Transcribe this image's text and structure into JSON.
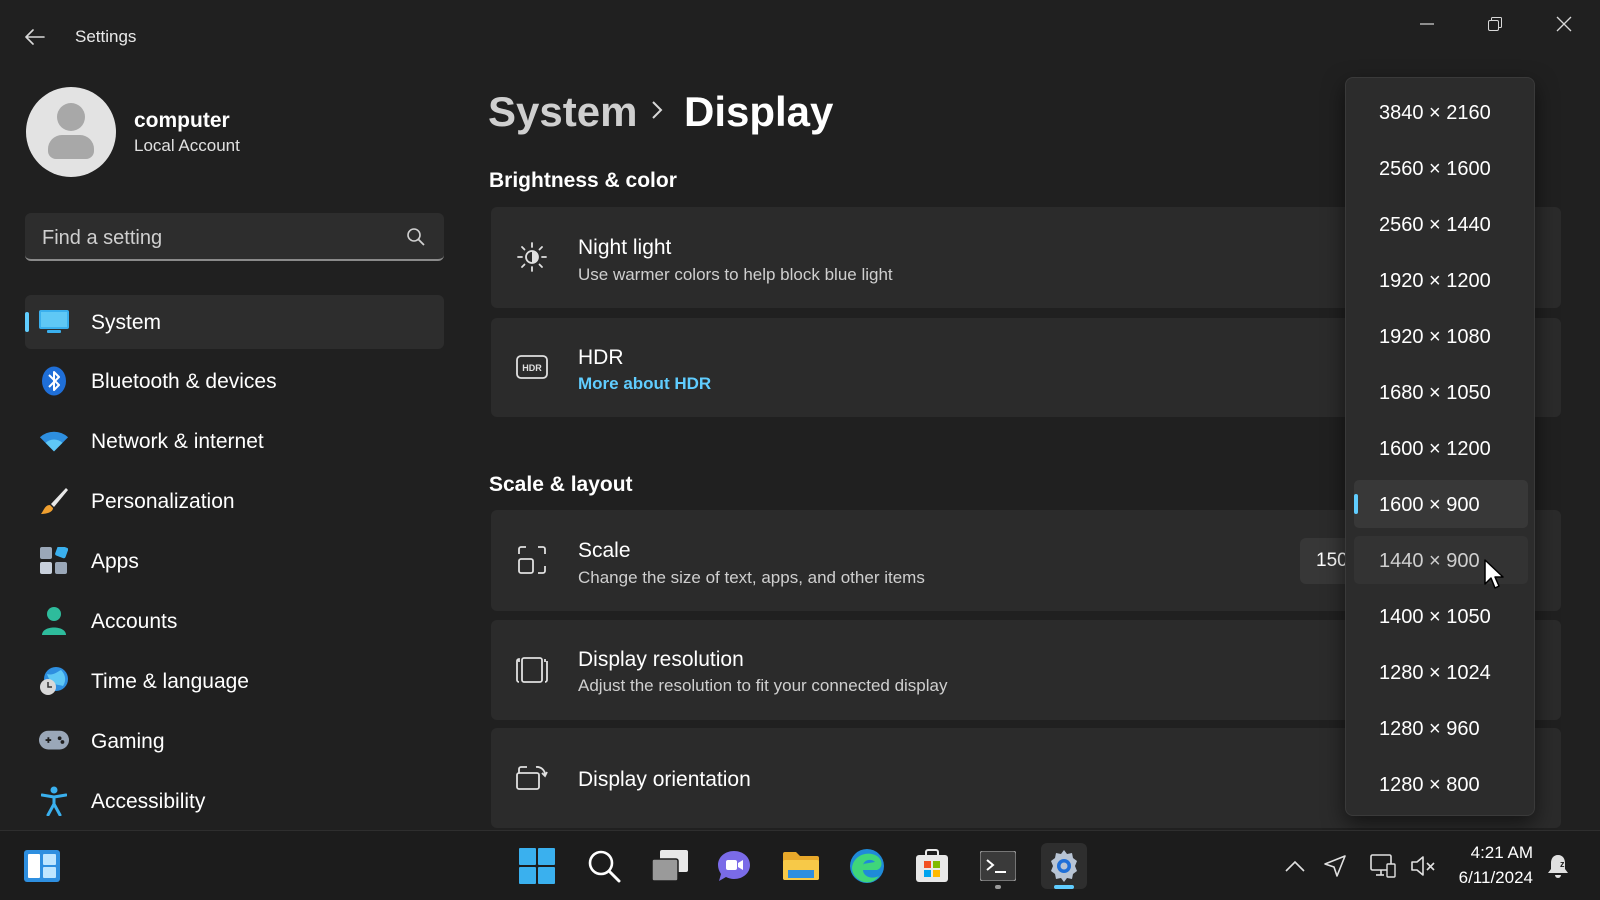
{
  "titlebar": {
    "app_title": "Settings"
  },
  "user": {
    "name": "computer",
    "account_type": "Local Account"
  },
  "search": {
    "placeholder": "Find a setting"
  },
  "sidebar": {
    "items": [
      {
        "label": "System",
        "icon": "monitor-icon",
        "selected": true
      },
      {
        "label": "Bluetooth & devices",
        "icon": "bluetooth-icon"
      },
      {
        "label": "Network & internet",
        "icon": "wifi-icon"
      },
      {
        "label": "Personalization",
        "icon": "brush-icon"
      },
      {
        "label": "Apps",
        "icon": "apps-icon"
      },
      {
        "label": "Accounts",
        "icon": "account-icon"
      },
      {
        "label": "Time & language",
        "icon": "globe-clock-icon"
      },
      {
        "label": "Gaming",
        "icon": "gamepad-icon"
      },
      {
        "label": "Accessibility",
        "icon": "accessibility-icon"
      }
    ]
  },
  "breadcrumb": {
    "parent": "System",
    "current": "Display"
  },
  "sections": {
    "brightness": "Brightness & color",
    "scale_layout": "Scale & layout"
  },
  "cards": {
    "night_light": {
      "title": "Night light",
      "subtitle": "Use warmer colors to help block blue light"
    },
    "hdr": {
      "title": "HDR",
      "link": "More about HDR"
    },
    "scale": {
      "title": "Scale",
      "subtitle": "Change the size of text, apps, and other items",
      "value": "150"
    },
    "resolution": {
      "title": "Display resolution",
      "subtitle": "Adjust the resolution to fit your connected display"
    },
    "orientation": {
      "title": "Display orientation"
    }
  },
  "resolution_options": [
    "3840 × 2160",
    "2560 × 1600",
    "2560 × 1440",
    "1920 × 1200",
    "1920 × 1080",
    "1680 × 1050",
    "1600 × 1200",
    "1600 × 900",
    "1440 × 900",
    "1400 × 1050",
    "1280 × 1024",
    "1280 × 960",
    "1280 × 800"
  ],
  "resolution_selected": "1600 × 900",
  "resolution_hovered": "1440 × 900",
  "taskbar": {
    "time": "4:21 AM",
    "date": "6/11/2024"
  },
  "colors": {
    "accent": "#60cdff",
    "background": "#202020",
    "card": "#2b2b2b"
  }
}
